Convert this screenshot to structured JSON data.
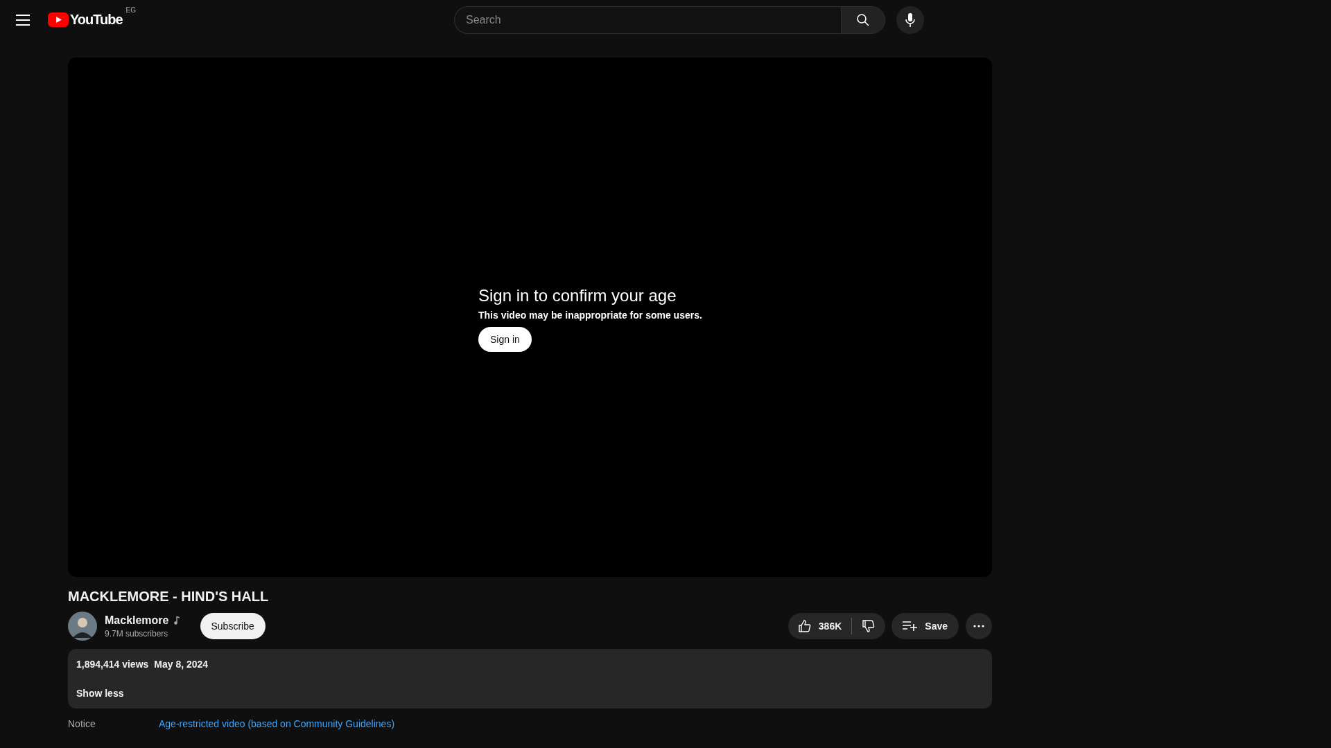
{
  "header": {
    "logo_text": "YouTube",
    "country_code": "EG",
    "search": {
      "placeholder": "Search"
    }
  },
  "player": {
    "message_title": "Sign in to confirm your age",
    "message_text": "This video may be inappropriate for some users.",
    "button": "Sign in"
  },
  "video": {
    "title": "MACKLEMORE - HIND'S HALL",
    "channel": {
      "name": "Macklemore",
      "subscribers": "9.7M subscribers",
      "subscribe_button": "Subscribe"
    },
    "likes": "386K",
    "save_button": "Save"
  },
  "description": {
    "views": "1,894,414 views",
    "date": "May 8, 2024",
    "toggle": "Show less"
  },
  "notice": {
    "label": "Notice",
    "link": "Age-restricted video (based on Community Guidelines)"
  }
}
